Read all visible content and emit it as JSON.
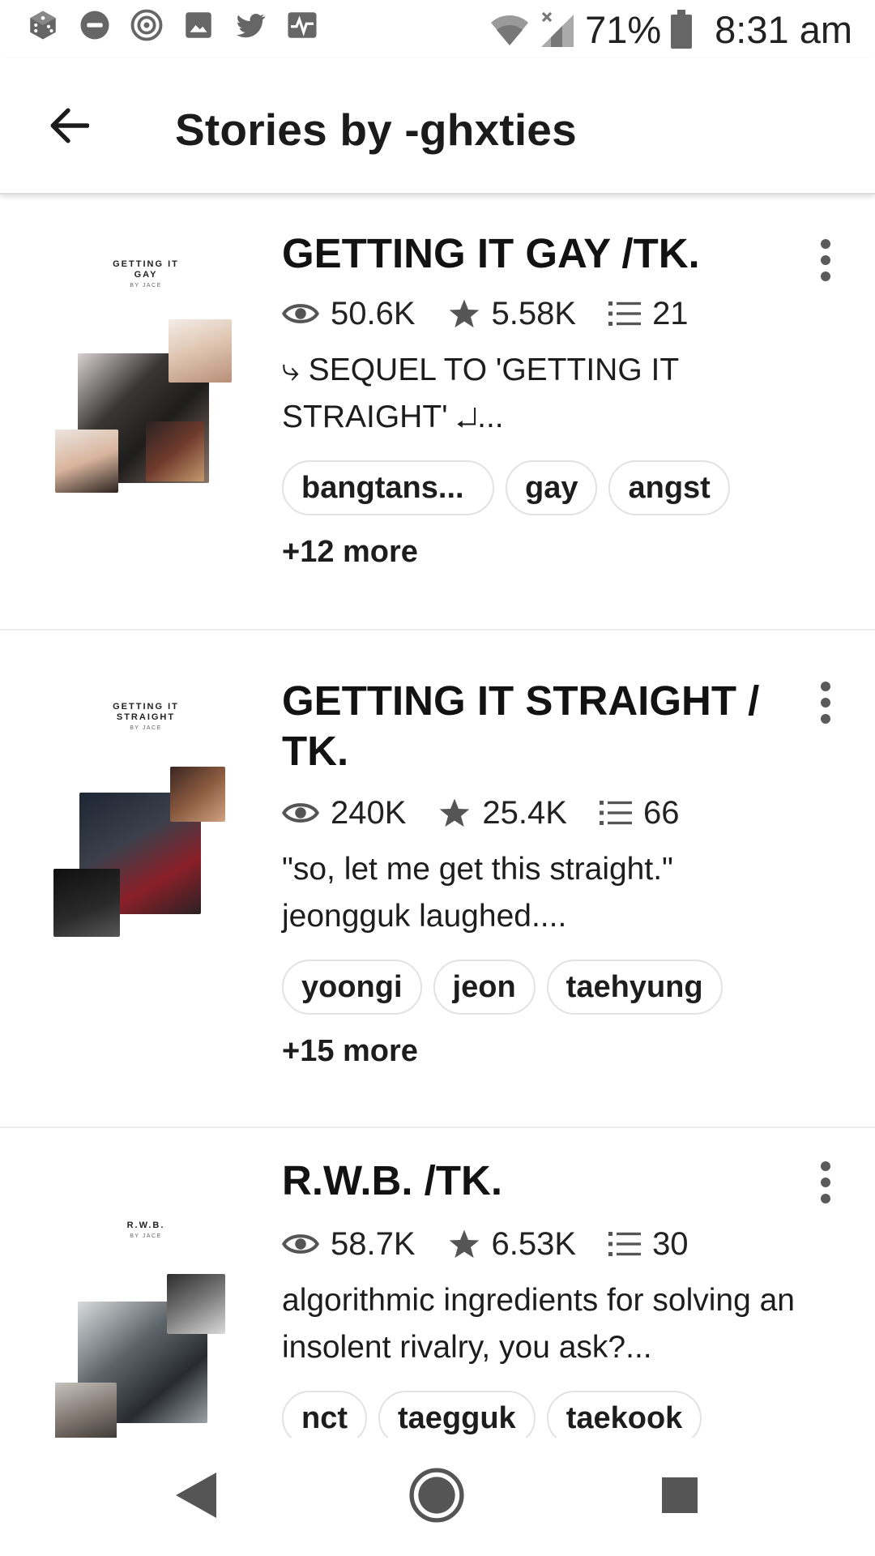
{
  "status_bar": {
    "left_icons": [
      "dice-icon",
      "do-not-disturb-icon",
      "target-icon",
      "image-icon",
      "twitter-icon",
      "activity-icon"
    ],
    "right_icons": [
      "wifi-icon",
      "signal-icon",
      "battery-icon"
    ],
    "battery_percent": "71%",
    "time": "8:31 am"
  },
  "app_bar": {
    "back_icon": "arrow-left-icon",
    "title": "Stories by -ghxties"
  },
  "stories": [
    {
      "cover_title_lines": [
        "GETTING IT",
        "GAY"
      ],
      "cover_by": "BY JACE",
      "title": "GETTING IT GAY /TK.",
      "reads": "50.6K",
      "votes": "5.58K",
      "parts": "21",
      "description": "⤷ SEQUEL TO 'GETTING IT STRAIGHT' ↵...",
      "tags": [
        "bangtans...",
        "gay",
        "angst"
      ],
      "more_tags": "+12 more"
    },
    {
      "cover_title_lines": [
        "GETTING IT",
        "STRAIGHT"
      ],
      "cover_by": "BY JACE",
      "title": "GETTING IT STRAIGHT / TK.",
      "reads": "240K",
      "votes": "25.4K",
      "parts": "66",
      "description": "\"so, let me get this straight.\" jeongguk laughed....",
      "tags": [
        "yoongi",
        "jeon",
        "taehyung"
      ],
      "more_tags": "+15 more"
    },
    {
      "cover_title_lines": [
        "R.W.B."
      ],
      "cover_by": "BY JACE",
      "title": "R.W.B. /TK.",
      "reads": "58.7K",
      "votes": "6.53K",
      "parts": "30",
      "description": "algorithmic ingredients for solving an insolent rivalry, you ask?...",
      "tags": [
        "nct",
        "taegguk",
        "taekook"
      ],
      "more_tags": ""
    }
  ],
  "nav_bar": {
    "icons": [
      "back-triangle-icon",
      "home-circle-icon",
      "recents-square-icon"
    ]
  },
  "colors": {
    "text": "#121212",
    "icon_gray": "#5a5a5a",
    "divider": "#ececec"
  }
}
